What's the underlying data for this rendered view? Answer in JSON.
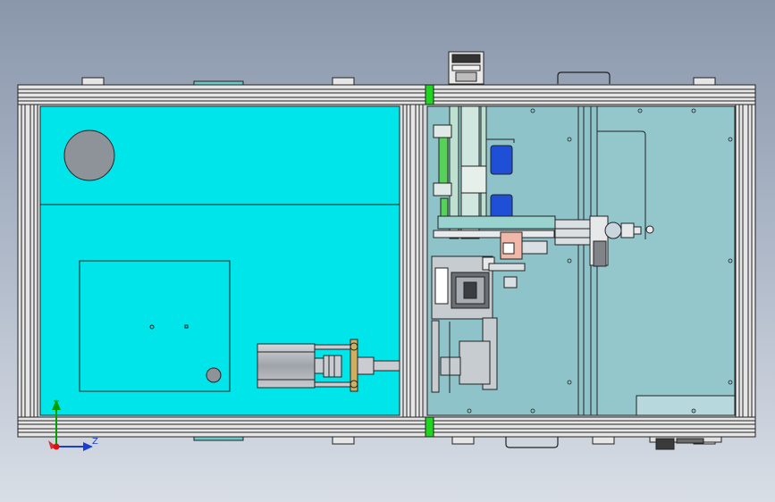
{
  "viewport": {
    "background_top": "#8a97ab",
    "background_bottom": "#d9dee6"
  },
  "colors": {
    "frame_outline": "#222222",
    "frame_fill": "#e6e6e6",
    "cyan_panel": "#00e5ea",
    "teal_panel": "#8ec3c9",
    "blue_block": "#1f4fd6",
    "green_connector": "#1fd61f",
    "motor_gray": "#b9bdc3",
    "copper": "#d0b060",
    "axis_y": "#00a000",
    "axis_z": "#1a3fd0",
    "axis_origin": "#e01010"
  },
  "triad": {
    "y_label": "Y",
    "z_label": "Z"
  }
}
